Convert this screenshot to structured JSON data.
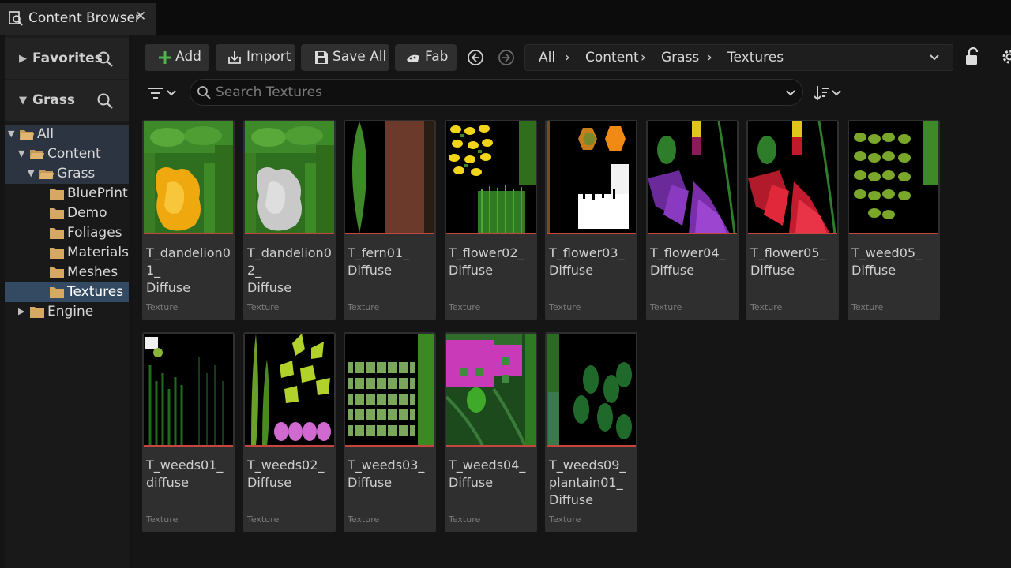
{
  "tab": {
    "label": "Content Browser",
    "close": "✕"
  },
  "sidebar": {
    "favorites": "Favorites",
    "root": "Grass",
    "tree": [
      {
        "label": "All"
      },
      {
        "label": "Content"
      },
      {
        "label": "Grass"
      },
      {
        "label": "BluePrint"
      },
      {
        "label": "Demo"
      },
      {
        "label": "Foliages"
      },
      {
        "label": "Materials"
      },
      {
        "label": "Meshes"
      },
      {
        "label": "Textures"
      },
      {
        "label": "Engine"
      }
    ]
  },
  "toolbar": {
    "add": "Add",
    "import": "Import",
    "save_all": "Save All",
    "fab": "Fab"
  },
  "breadcrumb": [
    "All",
    "Content",
    "Grass",
    "Textures"
  ],
  "search": {
    "placeholder": "Search Textures",
    "value": ""
  },
  "assets": [
    {
      "name": "T_dandelion01_\nDiffuse",
      "type": "Texture",
      "thumb": "dandelion01"
    },
    {
      "name": "T_dandelion02_\nDiffuse",
      "type": "Texture",
      "thumb": "dandelion02"
    },
    {
      "name": "T_fern01_\nDiffuse",
      "type": "Texture",
      "thumb": "fern01"
    },
    {
      "name": "T_flower02_\nDiffuse",
      "type": "Texture",
      "thumb": "flower02"
    },
    {
      "name": "T_flower03_\nDiffuse",
      "type": "Texture",
      "thumb": "flower03"
    },
    {
      "name": "T_flower04_\nDiffuse",
      "type": "Texture",
      "thumb": "flower04"
    },
    {
      "name": "T_flower05_\nDiffuse",
      "type": "Texture",
      "thumb": "flower05"
    },
    {
      "name": "T_weed05_\nDiffuse",
      "type": "Texture",
      "thumb": "weed05"
    },
    {
      "name": "T_weeds01_\ndiffuse",
      "type": "Texture",
      "thumb": "weeds01"
    },
    {
      "name": "T_weeds02_\nDiffuse",
      "type": "Texture",
      "thumb": "weeds02"
    },
    {
      "name": "T_weeds03_\nDiffuse",
      "type": "Texture",
      "thumb": "weeds03"
    },
    {
      "name": "T_weeds04_\nDiffuse",
      "type": "Texture",
      "thumb": "weeds04"
    },
    {
      "name": "T_weeds09_\nplantain01_\nDiffuse",
      "type": "Texture",
      "thumb": "plantain01"
    }
  ],
  "colors": {
    "selection": "#344a63",
    "texture_bar": "#c4463e",
    "add_icon": "#4fb34f"
  }
}
